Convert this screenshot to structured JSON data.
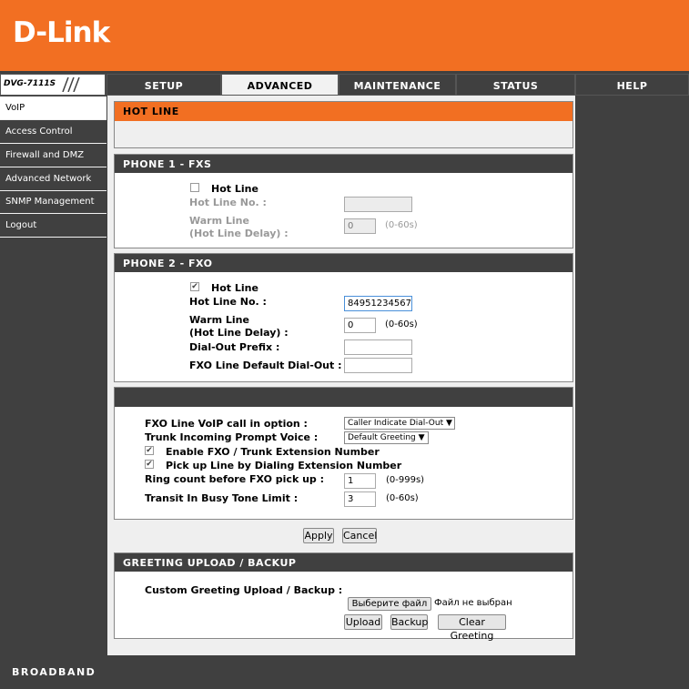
{
  "brand": {
    "logo": "D-Link",
    "model": "DVG-7111S",
    "footer": "BROADBAND"
  },
  "tabs": [
    {
      "label": "SETUP"
    },
    {
      "label": "ADVANCED"
    },
    {
      "label": "MAINTENANCE"
    },
    {
      "label": "STATUS"
    },
    {
      "label": "HELP"
    }
  ],
  "active_tab": "ADVANCED",
  "sidebar": {
    "items": [
      {
        "label": "VoIP"
      },
      {
        "label": "Access Control"
      },
      {
        "label": "Firewall and DMZ"
      },
      {
        "label": "Advanced Network"
      },
      {
        "label": "SNMP Management"
      },
      {
        "label": "Logout"
      }
    ],
    "active": "VoIP"
  },
  "hotline": {
    "title": "HOT LINE"
  },
  "fxs": {
    "title": "PHONE 1 - FXS",
    "hotline_label": "Hot Line",
    "hotline_checked": false,
    "number_label": "Hot Line No. :",
    "number_value": "",
    "warm_label1": "Warm Line",
    "warm_label2": "(Hot Line Delay) :",
    "warm_value": "0",
    "warm_range": "(0-60s)"
  },
  "fxo": {
    "title": "PHONE 2 - FXO",
    "hotline_label": "Hot Line",
    "hotline_checked": true,
    "number_label": "Hot Line No. :",
    "number_value": "84951234567",
    "warm_label1": "Warm Line",
    "warm_label2": "(Hot Line Delay) :",
    "warm_value": "0",
    "warm_range": "(0-60s)",
    "prefix_label": "Dial-Out Prefix :",
    "prefix_value": "",
    "default_label": "FXO Line Default Dial-Out :",
    "default_value": ""
  },
  "options": {
    "voip_call_label": "FXO Line VoIP call in option :",
    "voip_call_value": "Caller Indicate Dial-Out",
    "prompt_label": "Trunk Incoming Prompt Voice :",
    "prompt_value": "Default Greeting",
    "ext_label": "Enable FXO / Trunk Extension Number",
    "ext_checked": true,
    "pickup_label": "Pick up Line by Dialing Extension Number",
    "pickup_checked": true,
    "ring_label": "Ring count before FXO pick up :",
    "ring_value": "1",
    "ring_range": "(0-999s)",
    "busy_label": "Transit In Busy Tone Limit :",
    "busy_value": "3",
    "busy_range": "(0-60s)"
  },
  "actions": {
    "apply": "Apply",
    "cancel": "Cancel"
  },
  "greeting": {
    "title": "GREETING UPLOAD / BACKUP",
    "label": "Custom Greeting Upload / Backup :",
    "choose_file": "Выберите файл",
    "no_file": "Файл не выбран",
    "upload": "Upload",
    "backup": "Backup",
    "clear": "Clear Greeting"
  }
}
